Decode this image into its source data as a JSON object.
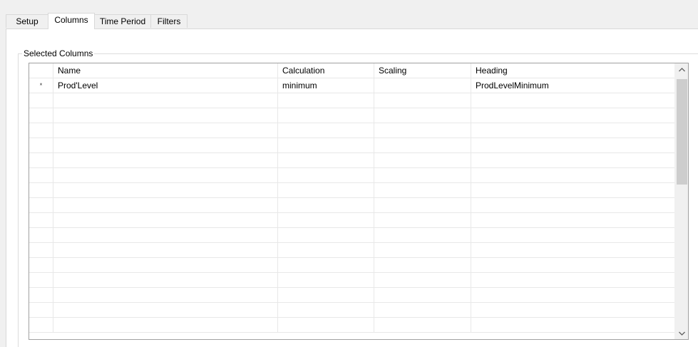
{
  "tabs": [
    {
      "label": "Setup",
      "active": false
    },
    {
      "label": "Columns",
      "active": true
    },
    {
      "label": "Time Period",
      "active": false
    },
    {
      "label": "Filters",
      "active": false
    }
  ],
  "group": {
    "title": "Selected Columns"
  },
  "grid": {
    "columns": [
      "",
      "Name",
      "Calculation",
      "Scaling",
      "Heading"
    ],
    "rows": [
      [
        "*",
        "Prod'Level",
        "minimum",
        "",
        "ProdLevelMinimum"
      ],
      [
        "",
        "",
        "",
        "",
        ""
      ],
      [
        "",
        "",
        "",
        "",
        ""
      ],
      [
        "",
        "",
        "",
        "",
        ""
      ],
      [
        "",
        "",
        "",
        "",
        ""
      ],
      [
        "",
        "",
        "",
        "",
        ""
      ],
      [
        "",
        "",
        "",
        "",
        ""
      ],
      [
        "",
        "",
        "",
        "",
        ""
      ],
      [
        "",
        "",
        "",
        "",
        ""
      ],
      [
        "",
        "",
        "",
        "",
        ""
      ],
      [
        "",
        "",
        "",
        "",
        ""
      ],
      [
        "",
        "",
        "",
        "",
        ""
      ],
      [
        "",
        "",
        "",
        "",
        ""
      ],
      [
        "",
        "",
        "",
        "",
        ""
      ],
      [
        "",
        "",
        "",
        "",
        ""
      ],
      [
        "",
        "",
        "",
        "",
        ""
      ],
      [
        "",
        "",
        "",
        "",
        ""
      ]
    ]
  },
  "scrollbar": {
    "up_icon": "chevron-up-icon",
    "down_icon": "chevron-down-icon"
  }
}
